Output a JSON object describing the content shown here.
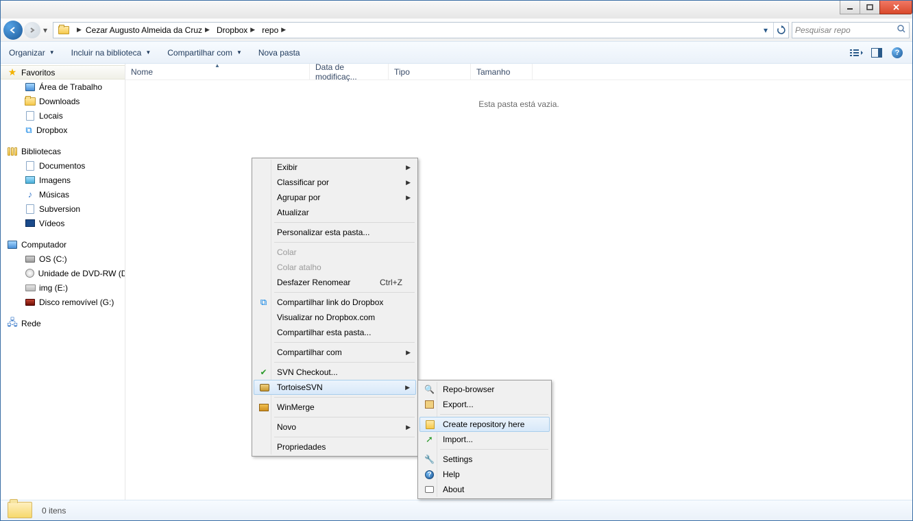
{
  "breadcrumb": {
    "parts": [
      "Cezar Augusto Almeida da Cruz",
      "Dropbox",
      "repo"
    ]
  },
  "search": {
    "placeholder": "Pesquisar repo"
  },
  "toolbar": {
    "organize": "Organizar",
    "include": "Incluir na biblioteca",
    "share": "Compartilhar com",
    "newfolder": "Nova pasta"
  },
  "columns": {
    "name": "Nome",
    "date": "Data de modificaç...",
    "type": "Tipo",
    "size": "Tamanho"
  },
  "main": {
    "empty": "Esta pasta está vazia."
  },
  "sidebar": {
    "favorites": "Favoritos",
    "desktop": "Área de Trabalho",
    "downloads": "Downloads",
    "places": "Locais",
    "dropbox": "Dropbox",
    "libraries": "Bibliotecas",
    "documents": "Documentos",
    "pictures": "Imagens",
    "music": "Músicas",
    "subversion": "Subversion",
    "videos": "Vídeos",
    "computer": "Computador",
    "osdrive": "OS (C:)",
    "dvd": "Unidade de DVD-RW (D:)",
    "img": "img (E:)",
    "removable": "Disco removível (G:)",
    "network": "Rede"
  },
  "statusbar": {
    "items": "0 itens"
  },
  "ctx1": {
    "view": "Exibir",
    "sort": "Classificar por",
    "group": "Agrupar por",
    "refresh": "Atualizar",
    "customize": "Personalizar esta pasta...",
    "paste": "Colar",
    "paste_shortcut": "Colar atalho",
    "undo_rename": "Desfazer Renomear",
    "undo_key": "Ctrl+Z",
    "dropbox_link": "Compartilhar link do Dropbox",
    "dropbox_view": "Visualizar no Dropbox.com",
    "share_folder": "Compartilhar esta pasta...",
    "share_with": "Compartilhar com",
    "svn_checkout": "SVN Checkout...",
    "tortoise": "TortoiseSVN",
    "winmerge": "WinMerge",
    "new": "Novo",
    "properties": "Propriedades"
  },
  "ctx2": {
    "repo_browser": "Repo-browser",
    "export": "Export...",
    "create_repo": "Create repository here",
    "import": "Import...",
    "settings": "Settings",
    "help": "Help",
    "about": "About"
  }
}
